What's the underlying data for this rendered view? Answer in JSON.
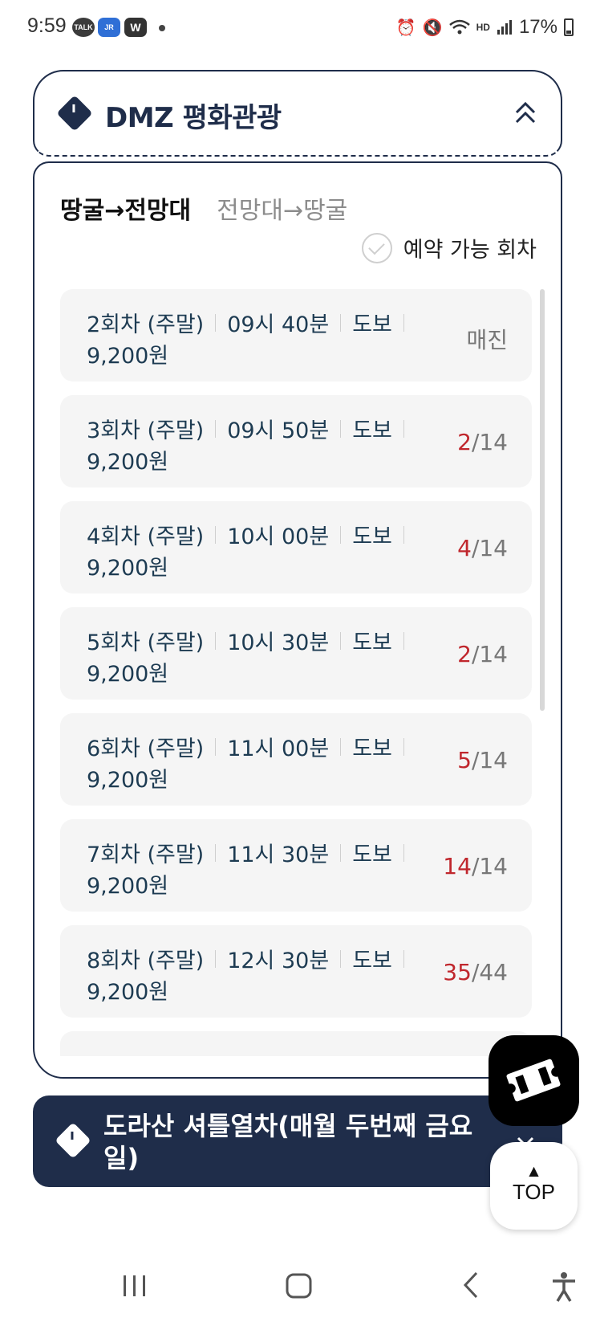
{
  "status_bar": {
    "time": "9:59",
    "apps": [
      "TALK",
      "JR",
      "W"
    ],
    "battery": "17%"
  },
  "section1": {
    "title": "DMZ 평화관광",
    "icon": "clock-icon",
    "tabs": [
      {
        "label": "땅굴→전망대",
        "active": true
      },
      {
        "label": "전망대→땅굴",
        "active": false
      }
    ],
    "legend": "예약 가능 회차",
    "rows": [
      {
        "round": "2회차 (주말)",
        "time": "09시 40분",
        "type": "도보",
        "price": "9,200원",
        "status": "매진",
        "avail": "",
        "total": ""
      },
      {
        "round": "3회차 (주말)",
        "time": "09시 50분",
        "type": "도보",
        "price": "9,200원",
        "status": "",
        "avail": "2",
        "total": "/14"
      },
      {
        "round": "4회차 (주말)",
        "time": "10시 00분",
        "type": "도보",
        "price": "9,200원",
        "status": "",
        "avail": "4",
        "total": "/14"
      },
      {
        "round": "5회차 (주말)",
        "time": "10시 30분",
        "type": "도보",
        "price": "9,200원",
        "status": "",
        "avail": "2",
        "total": "/14"
      },
      {
        "round": "6회차 (주말)",
        "time": "11시 00분",
        "type": "도보",
        "price": "9,200원",
        "status": "",
        "avail": "5",
        "total": "/14"
      },
      {
        "round": "7회차 (주말)",
        "time": "11시 30분",
        "type": "도보",
        "price": "9,200원",
        "status": "",
        "avail": "14",
        "total": "/14"
      },
      {
        "round": "8회차 (주말)",
        "time": "12시 30분",
        "type": "도보",
        "price": "9,200원",
        "status": "",
        "avail": "35",
        "total": "/44"
      }
    ]
  },
  "section2": {
    "title": "도라산 셔틀열차(매월 두번째 금요일)"
  },
  "fab": {
    "ticket_icon": "ticket-icon",
    "top_arrow": "▲",
    "top_label": "TOP"
  },
  "colors": {
    "navy": "#1f2d4a",
    "available_red": "#c0272d",
    "row_bg": "#f5f5f5"
  }
}
